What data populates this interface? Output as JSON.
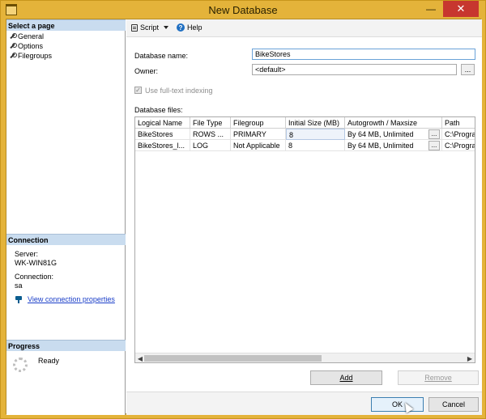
{
  "window": {
    "title": "New Database"
  },
  "left": {
    "select_page_header": "Select a page",
    "pages": [
      "General",
      "Options",
      "Filegroups"
    ],
    "connection_header": "Connection",
    "server_label": "Server:",
    "server_value": "WK-WIN81G",
    "connection_label": "Connection:",
    "connection_value": "sa",
    "view_link": "View connection properties",
    "progress_header": "Progress",
    "progress_status": "Ready"
  },
  "toolbar": {
    "script_label": "Script",
    "help_label": "Help"
  },
  "form": {
    "db_name_label": "Database name:",
    "db_name_value": "BikeStores",
    "owner_label": "Owner:",
    "owner_value": "<default>",
    "browse_label": "...",
    "fulltext_label": "Use full-text indexing",
    "db_files_label": "Database files:"
  },
  "grid": {
    "columns": [
      "Logical Name",
      "File Type",
      "Filegroup",
      "Initial Size (MB)",
      "Autogrowth / Maxsize",
      "Path"
    ],
    "rows": [
      {
        "logical": "BikeStores",
        "type": "ROWS ...",
        "filegroup": "PRIMARY",
        "size": "8",
        "autogrowth": "By 64 MB, Unlimited",
        "btn": "...",
        "path": "C:\\Progra"
      },
      {
        "logical": "BikeStores_l...",
        "type": "LOG",
        "filegroup": "Not Applicable",
        "size": "8",
        "autogrowth": "By 64 MB, Unlimited",
        "btn": "...",
        "path": "C:\\Progra"
      }
    ]
  },
  "buttons": {
    "add": "Add",
    "remove": "Remove",
    "ok": "OK",
    "cancel": "Cancel"
  },
  "window_controls": {
    "minimize": "—",
    "close": "✕"
  }
}
